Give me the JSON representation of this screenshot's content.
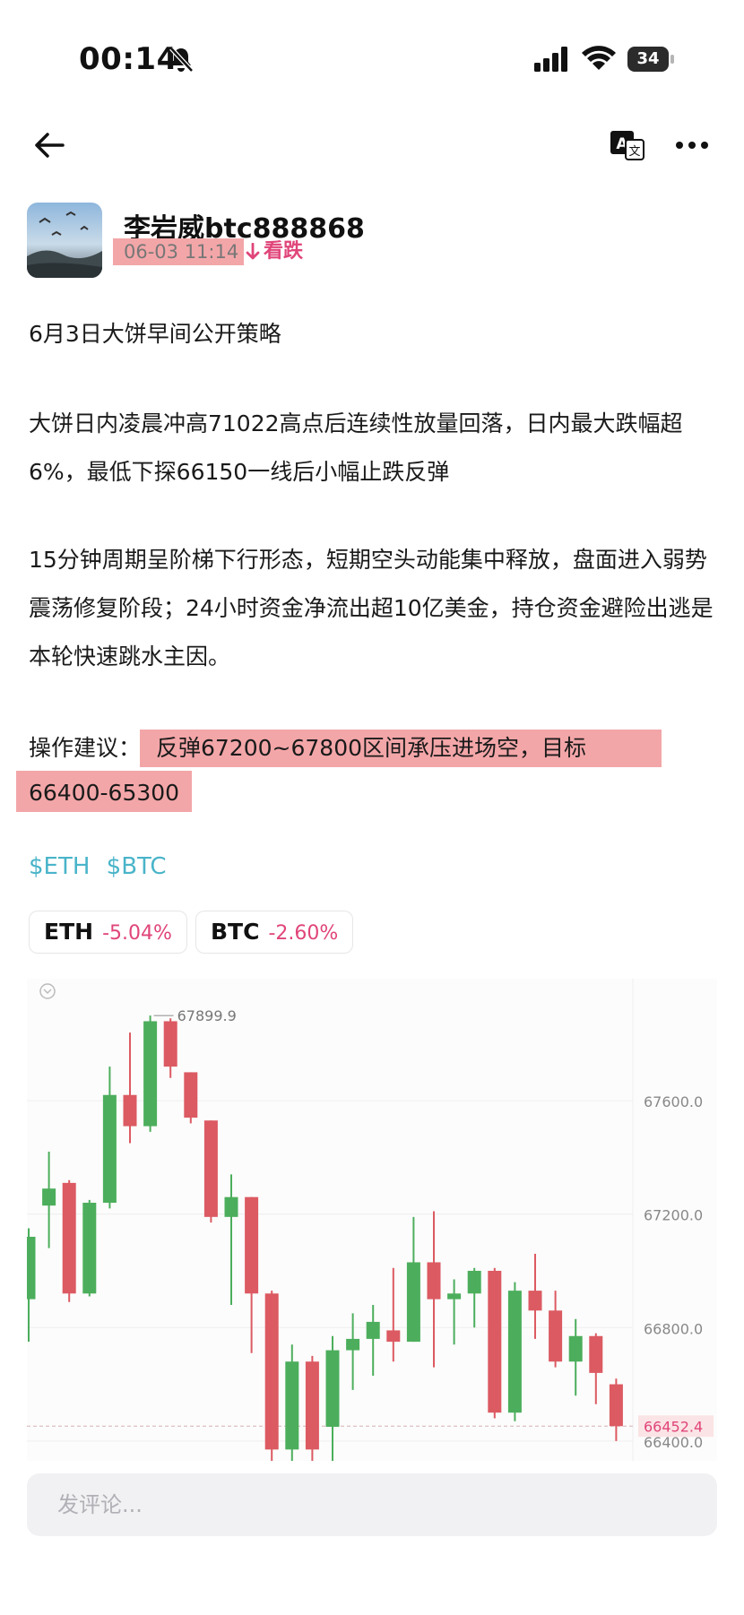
{
  "status_bar": {
    "time": "00:14",
    "battery": "34"
  },
  "post": {
    "author": "李岩威btc888868",
    "time": "06-03 11:14",
    "sentiment": "看跌",
    "title": "6月3日大饼早间公开策略",
    "paragraph1": "大饼日内凌晨冲高71022高点后连续性放量回落，日内最大跌幅超6%，最低下探66150一线后小幅止跌反弹",
    "paragraph2": "15分钟周期呈阶梯下行形态，短期空头动能集中释放，盘面进入弱势震荡修复阶段；24小时资金净流出超10亿美金，持仓资金避险出逃是本轮快速跳水主因。",
    "advice_label": "操作建议：",
    "advice_line1": "反弹67200~67800区间承压进场空，目标",
    "advice_line2": "66400-65300",
    "tags": [
      "$ETH",
      "$BTC"
    ]
  },
  "tickers": [
    {
      "symbol": "ETH",
      "change": "-5.04%"
    },
    {
      "symbol": "BTC",
      "change": "-2.60%"
    }
  ],
  "chart_data": {
    "type": "candlestick",
    "price_axis_ticks": [
      "67600.0",
      "67200.0",
      "66800.0",
      "66400.0"
    ],
    "y_ticks": [
      67600,
      67200,
      66800,
      66400
    ],
    "ylim": [
      66330,
      68030
    ],
    "high_label": "67899.9",
    "last_price_label": "66452.4",
    "last_price": 66452.4,
    "up_color": "#4cae5c",
    "down_color": "#dc5a62",
    "candles": [
      {
        "o": 66900,
        "h": 67150,
        "l": 66750,
        "c": 67120
      },
      {
        "o": 67230,
        "h": 67420,
        "l": 67080,
        "c": 67290
      },
      {
        "o": 67310,
        "h": 67320,
        "l": 66890,
        "c": 66920
      },
      {
        "o": 66920,
        "h": 67250,
        "l": 66910,
        "c": 67240
      },
      {
        "o": 67240,
        "h": 67720,
        "l": 67220,
        "c": 67620
      },
      {
        "o": 67620,
        "h": 67840,
        "l": 67450,
        "c": 67510
      },
      {
        "o": 67510,
        "h": 67899.9,
        "l": 67490,
        "c": 67880
      },
      {
        "o": 67880,
        "h": 67890,
        "l": 67680,
        "c": 67720
      },
      {
        "o": 67700,
        "h": 67700,
        "l": 67520,
        "c": 67540
      },
      {
        "o": 67530,
        "h": 67530,
        "l": 67170,
        "c": 67190
      },
      {
        "o": 67190,
        "h": 67340,
        "l": 66880,
        "c": 67260
      },
      {
        "o": 67260,
        "h": 67260,
        "l": 66710,
        "c": 66920
      },
      {
        "o": 66920,
        "h": 66930,
        "l": 66330,
        "c": 66370
      },
      {
        "o": 66370,
        "h": 66740,
        "l": 66330,
        "c": 66680
      },
      {
        "o": 66680,
        "h": 66700,
        "l": 66330,
        "c": 66370
      },
      {
        "o": 66450,
        "h": 66770,
        "l": 66330,
        "c": 66720
      },
      {
        "o": 66720,
        "h": 66850,
        "l": 66580,
        "c": 66760
      },
      {
        "o": 66760,
        "h": 66880,
        "l": 66630,
        "c": 66820
      },
      {
        "o": 66790,
        "h": 67010,
        "l": 66680,
        "c": 66750
      },
      {
        "o": 66750,
        "h": 67190,
        "l": 66750,
        "c": 67030
      },
      {
        "o": 67030,
        "h": 67210,
        "l": 66660,
        "c": 66900
      },
      {
        "o": 66900,
        "h": 66970,
        "l": 66740,
        "c": 66920
      },
      {
        "o": 66920,
        "h": 67010,
        "l": 66800,
        "c": 67000
      },
      {
        "o": 67000,
        "h": 67010,
        "l": 66480,
        "c": 66500
      },
      {
        "o": 66500,
        "h": 66960,
        "l": 66470,
        "c": 66930
      },
      {
        "o": 66930,
        "h": 67060,
        "l": 66760,
        "c": 66860
      },
      {
        "o": 66860,
        "h": 66930,
        "l": 66660,
        "c": 66680
      },
      {
        "o": 66680,
        "h": 66830,
        "l": 66560,
        "c": 66770
      },
      {
        "o": 66770,
        "h": 66780,
        "l": 66530,
        "c": 66640
      },
      {
        "o": 66600,
        "h": 66620,
        "l": 66400,
        "c": 66452.4
      }
    ]
  },
  "comment": {
    "placeholder": "发评论..."
  }
}
